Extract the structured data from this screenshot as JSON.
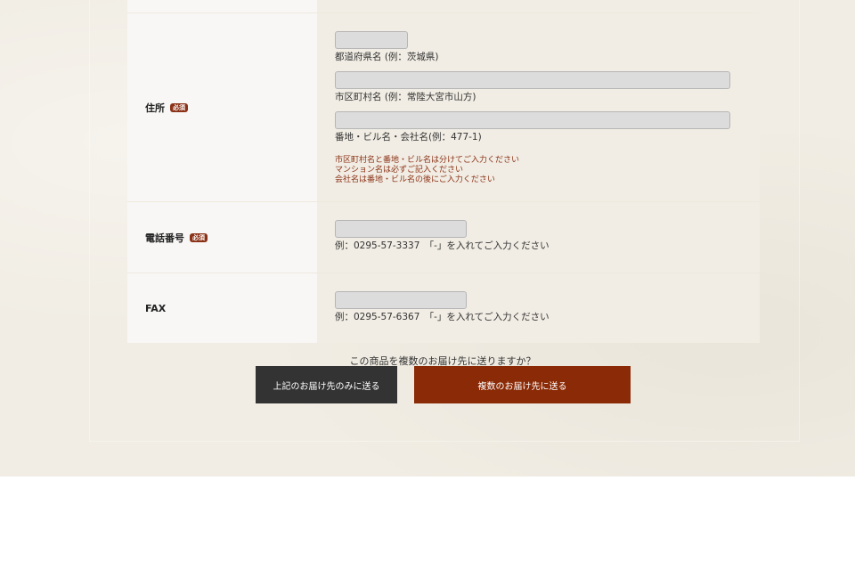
{
  "form": {
    "address": {
      "label": "住所",
      "required_badge": "必須",
      "prefecture_hint": "都道府県名 (例：茨城県)",
      "city_hint": "市区町村名 (例：常陸大宮市山方)",
      "street_hint": "番地・ビル名・会社名(例：477-1)",
      "notes": [
        "市区町村名と番地・ビル名は分けてご入力ください",
        "マンション名は必ずご記入ください",
        "会社名は番地・ビル名の後にご入力ください"
      ]
    },
    "phone": {
      "label": "電話番号",
      "required_badge": "必須",
      "hint": "例：0295-57-3337　「-」を入れてご入力ください"
    },
    "fax": {
      "label": "FAX",
      "hint": "例：0295-57-6367　「-」を入れてご入力ください"
    }
  },
  "delivery": {
    "question": "この商品を複数のお届け先に送りますか？",
    "single_button": "上記のお届け先のみに送る",
    "multiple_button": "複数のお届け先に送る"
  },
  "colors": {
    "accent": "#8b2a06",
    "required_badge": "#8b3216",
    "dark_button": "#333333",
    "background": "#f1ede4"
  }
}
